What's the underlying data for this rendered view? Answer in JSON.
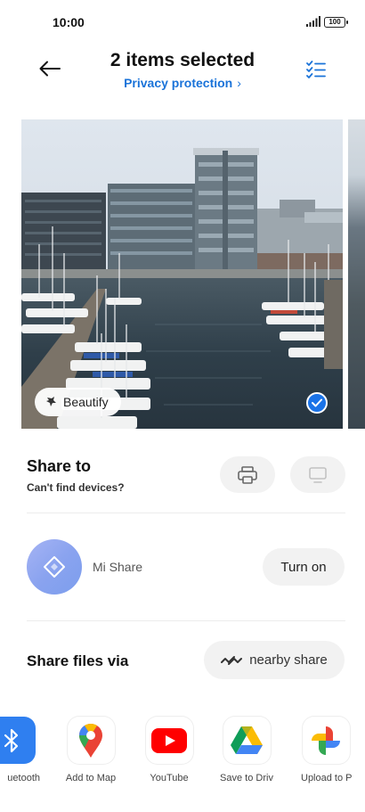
{
  "status_bar": {
    "time": "10:00",
    "battery": "100"
  },
  "header": {
    "title": "2 items selected",
    "subtitle": "Privacy protection",
    "back_icon": "arrow-left-icon",
    "select_icon": "checklist-icon"
  },
  "photo": {
    "beautify_label": "Beautify",
    "selected": true
  },
  "share_to": {
    "title": "Share to",
    "subtitle": "Can't find devices?",
    "devices": [
      {
        "icon": "printer-icon"
      },
      {
        "icon": "monitor-icon"
      }
    ]
  },
  "mi_share": {
    "label": "Mi Share",
    "button": "Turn on"
  },
  "share_files": {
    "title": "Share files via",
    "nearby_label": "nearby share"
  },
  "apps": [
    {
      "label": "uetooth",
      "icon": "bluetooth-icon"
    },
    {
      "label": "Add to Map",
      "icon": "google-maps-icon"
    },
    {
      "label": "YouTube",
      "icon": "youtube-icon"
    },
    {
      "label": "Save to Driv",
      "icon": "google-drive-icon"
    },
    {
      "label": "Upload to P",
      "icon": "google-photos-icon"
    }
  ],
  "colors": {
    "accent": "#1a73d9",
    "selected_badge": "#1a73e8",
    "pill_bg": "#f2f2f2"
  }
}
